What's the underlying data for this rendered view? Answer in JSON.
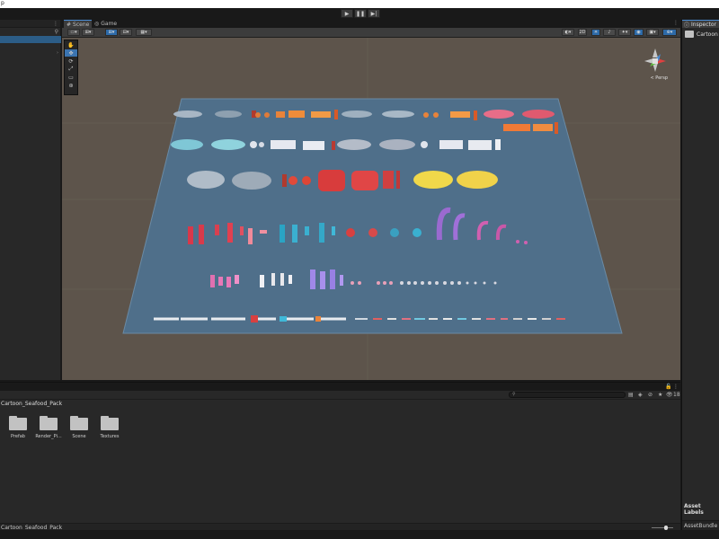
{
  "window": {
    "top_label": "p"
  },
  "play_controls": {
    "play": "▶",
    "pause": "❚❚",
    "step": "▶|"
  },
  "scene_tabs": [
    {
      "label": "Scene",
      "icon": "hash-icon"
    },
    {
      "label": "Game",
      "icon": "gamepad-icon"
    }
  ],
  "viewport": {
    "persp_label": "< Persp"
  },
  "inspector": {
    "tab_label": "Inspector",
    "selected_name": "Cartoon",
    "asset_labels": "Asset Labels",
    "asset_bundle": "AssetBundle"
  },
  "project": {
    "breadcrumb": "Cartoon_Seafood_Pack",
    "folders": [
      "Prefab",
      "Render_Pi...",
      "Scene",
      "Textures"
    ],
    "status_path": "Cartoon_Seafood_Pack",
    "count": "18"
  },
  "colors": {
    "accent": "#4a8cd4",
    "floor": "#4f6f8a",
    "background": "#5d544b"
  }
}
